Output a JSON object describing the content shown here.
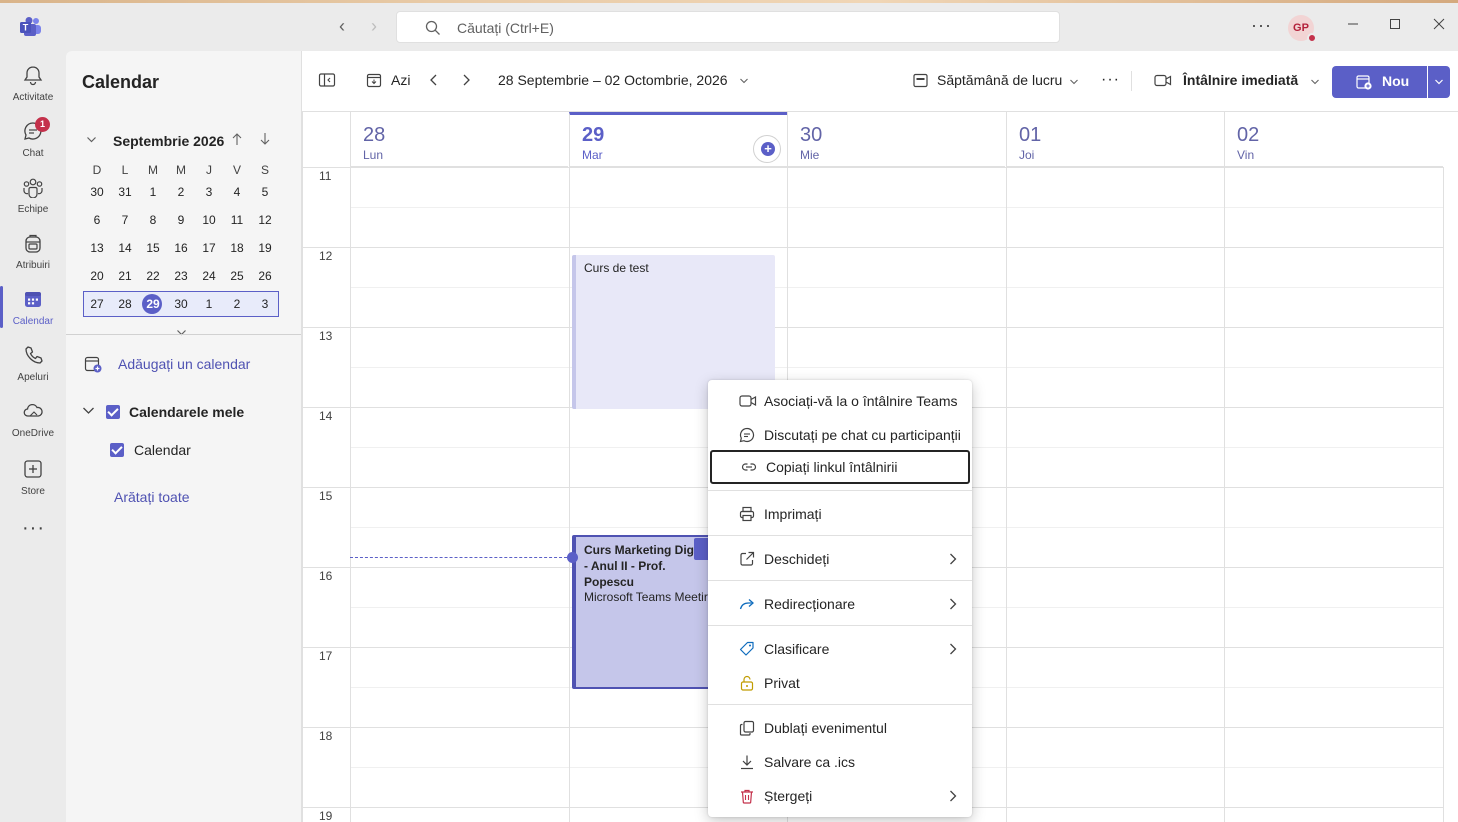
{
  "titlebar": {
    "search_placeholder": "Căutați (Ctrl+E)",
    "avatar_initials": "GP",
    "more_label": "···"
  },
  "rail": {
    "items": [
      {
        "label": "Activitate",
        "icon": "bell-icon"
      },
      {
        "label": "Chat",
        "icon": "chat-icon",
        "badge": "1"
      },
      {
        "label": "Echipe",
        "icon": "teams-icon"
      },
      {
        "label": "Atribuiri",
        "icon": "backpack-icon"
      },
      {
        "label": "Calendar",
        "icon": "calendar-icon",
        "active": true
      },
      {
        "label": "Apeluri",
        "icon": "phone-icon"
      },
      {
        "label": "OneDrive",
        "icon": "cloud-icon"
      },
      {
        "label": "Store",
        "icon": "store-icon"
      }
    ],
    "more": "···"
  },
  "panel": {
    "title": "Calendar",
    "month_label": "Septembrie 2026",
    "weekdays": [
      "D",
      "L",
      "M",
      "M",
      "J",
      "V",
      "S"
    ],
    "weeks": [
      [
        "30",
        "31",
        "1",
        "2",
        "3",
        "4",
        "5"
      ],
      [
        "6",
        "7",
        "8",
        "9",
        "10",
        "11",
        "12"
      ],
      [
        "13",
        "14",
        "15",
        "16",
        "17",
        "18",
        "19"
      ],
      [
        "20",
        "21",
        "22",
        "23",
        "24",
        "25",
        "26"
      ],
      [
        "27",
        "28",
        "29",
        "30",
        "1",
        "2",
        "3"
      ]
    ],
    "add_calendar": "Adăugați un calendar",
    "my_calendars": "Calendarele mele",
    "calendar_item": "Calendar",
    "show_all": "Arătați toate"
  },
  "toolbar": {
    "today": "Azi",
    "date_range": "28 Septembrie – 02 Octombrie, 2026",
    "view": "Săptămână de lucru",
    "meet_now": "Întâlnire imediată",
    "new": "Nou"
  },
  "days": [
    {
      "num": "28",
      "name": "Lun"
    },
    {
      "num": "29",
      "name": "Mar",
      "today": true
    },
    {
      "num": "30",
      "name": "Mie"
    },
    {
      "num": "01",
      "name": "Joi"
    },
    {
      "num": "02",
      "name": "Vin"
    }
  ],
  "hours": [
    "11",
    "12",
    "13",
    "14",
    "15",
    "16",
    "17",
    "18",
    "19"
  ],
  "events": [
    {
      "title": "Curs de test"
    },
    {
      "title": "Curs Marketing Digital - Anul II - Prof. Popescu",
      "subtitle": "Microsoft Teams Meetir"
    }
  ],
  "context_menu": {
    "items": [
      {
        "label": "Asociați-vă la o întâlnire Teams",
        "icon": "video-icon"
      },
      {
        "label": "Discutați pe chat cu participanții",
        "icon": "chat-icon"
      },
      {
        "label": "Copiați linkul întâlnirii",
        "icon": "link-icon",
        "focused": true
      },
      {
        "label": "Imprimați",
        "icon": "print-icon"
      },
      {
        "label": "Deschideți",
        "icon": "open-icon",
        "submenu": true
      },
      {
        "label": "Redirecționare",
        "icon": "forward-icon",
        "submenu": true
      },
      {
        "label": "Clasificare",
        "icon": "tag-icon",
        "submenu": true
      },
      {
        "label": "Privat",
        "icon": "lock-open-icon"
      },
      {
        "label": "Dublați evenimentul",
        "icon": "copy-icon"
      },
      {
        "label": "Salvare ca .ics",
        "icon": "download-icon"
      },
      {
        "label": "Ștergeți",
        "icon": "trash-icon",
        "submenu": true
      }
    ]
  },
  "colors": {
    "brand": "#5b5fc7",
    "event_light": "#e8e8f8",
    "event_selected": "#c5c6ea",
    "badge": "#c4314b"
  }
}
